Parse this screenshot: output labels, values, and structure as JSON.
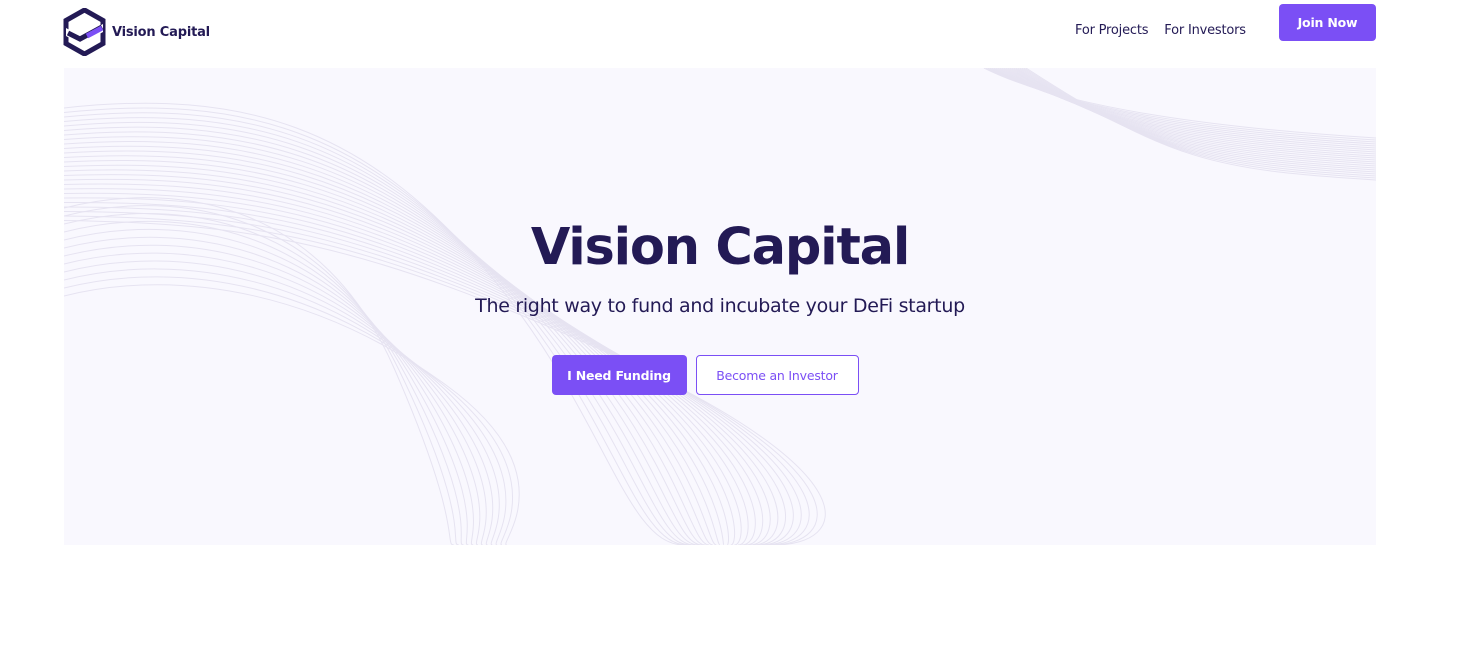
{
  "brand": {
    "name": "Vision Capital",
    "colors": {
      "primary": "#7b4ff5",
      "dark": "#231a55",
      "hero_bg": "#f9f8fe"
    }
  },
  "header": {
    "logo_icon": "hexagon-check-logo",
    "nav": [
      {
        "label": "For Projects"
      },
      {
        "label": "For Investors"
      }
    ],
    "cta_label": "Join Now"
  },
  "hero": {
    "title": "Vision Capital",
    "subtitle": "The right way to fund and incubate your DeFi startup",
    "primary_button": "I Need Funding",
    "secondary_button": "Become an Investor"
  }
}
